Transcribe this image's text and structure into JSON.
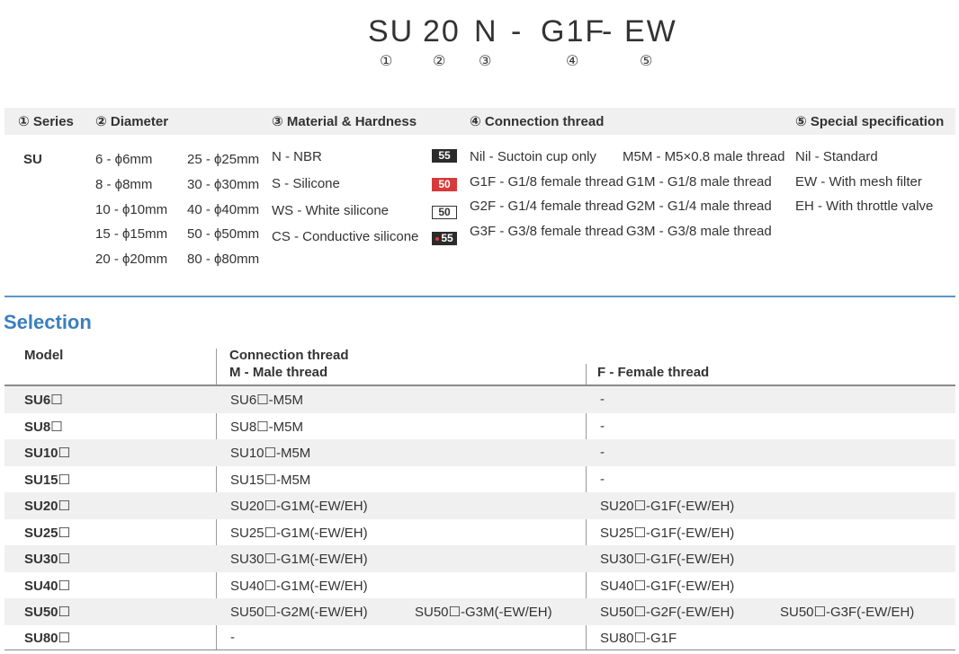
{
  "code": {
    "parts": [
      "SU",
      "20",
      "N",
      "-",
      "G1F",
      "-",
      "EW"
    ],
    "markers": [
      "①",
      "②",
      "③",
      "④",
      "⑤"
    ]
  },
  "headers": {
    "series": "① Series",
    "diameter": "② Diameter",
    "material": "③ Material & Hardness",
    "connection": "④ Connection thread",
    "special": "⑤ Special specification"
  },
  "series": {
    "value": "SU"
  },
  "diameter": {
    "col1": [
      "6  - ϕ6mm",
      "8  - ϕ8mm",
      "10 - ϕ10mm",
      "15 - ϕ15mm",
      "20 - ϕ20mm"
    ],
    "col2": [
      "25 - ϕ25mm",
      "30 - ϕ30mm",
      "40 - ϕ40mm",
      "50 - ϕ50mm",
      "80 - ϕ80mm"
    ]
  },
  "material": {
    "items": [
      "N   - NBR",
      "S   - Silicone",
      "WS - White silicone",
      "CS  - Conductive silicone"
    ],
    "badges": [
      "55",
      "50",
      "50",
      "55"
    ]
  },
  "connection": {
    "female": [
      "Nil  - Suctoin cup only",
      "G1F - G1/8 female thread",
      "G2F - G1/4 female thread",
      "G3F - G3/8 female thread"
    ],
    "male": [
      "M5M - M5×0.8 male thread",
      "G1M - G1/8 male thread",
      "G2M - G1/4 male thread",
      "G3M - G3/8 male thread"
    ]
  },
  "special": {
    "items": [
      "Nil - Standard",
      "EW - With mesh filter",
      "EH  - With throttle valve"
    ]
  },
  "selection": {
    "title": "Selection",
    "col_model": "Model",
    "col_connection": "Connection thread",
    "col_male": "M - Male thread",
    "col_female": "F - Female thread",
    "rows": [
      {
        "model": "SU6☐",
        "m1": "SU6☐-M5M",
        "m2": "",
        "f1": "-",
        "f2": ""
      },
      {
        "model": "SU8☐",
        "m1": "SU8☐-M5M",
        "m2": "",
        "f1": "-",
        "f2": ""
      },
      {
        "model": "SU10☐",
        "m1": "SU10☐-M5M",
        "m2": "",
        "f1": "-",
        "f2": ""
      },
      {
        "model": "SU15☐",
        "m1": "SU15☐-M5M",
        "m2": "",
        "f1": "-",
        "f2": ""
      },
      {
        "model": "SU20☐",
        "m1": "SU20☐-G1M(-EW/EH)",
        "m2": "",
        "f1": "SU20☐-G1F(-EW/EH)",
        "f2": ""
      },
      {
        "model": "SU25☐",
        "m1": "SU25☐-G1M(-EW/EH)",
        "m2": "",
        "f1": "SU25☐-G1F(-EW/EH)",
        "f2": ""
      },
      {
        "model": "SU30☐",
        "m1": "SU30☐-G1M(-EW/EH)",
        "m2": "",
        "f1": "SU30☐-G1F(-EW/EH)",
        "f2": ""
      },
      {
        "model": "SU40☐",
        "m1": "SU40☐-G1M(-EW/EH)",
        "m2": "",
        "f1": "SU40☐-G1F(-EW/EH)",
        "f2": ""
      },
      {
        "model": "SU50☐",
        "m1": "SU50☐-G2M(-EW/EH)",
        "m2": "SU50☐-G3M(-EW/EH)",
        "f1": "SU50☐-G2F(-EW/EH)",
        "f2": "SU50☐-G3F(-EW/EH)"
      },
      {
        "model": "SU80☐",
        "m1": "-",
        "m2": "",
        "f1": "SU80☐-G1F",
        "f2": ""
      }
    ]
  }
}
